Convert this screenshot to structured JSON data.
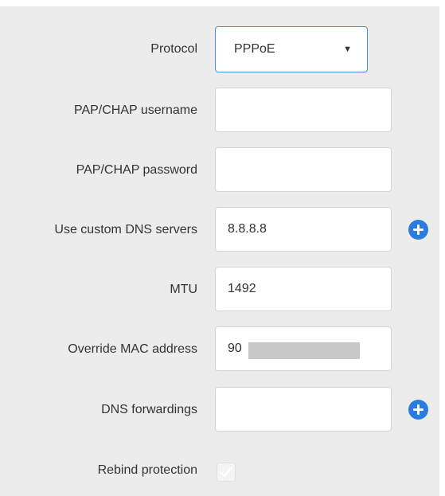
{
  "form": {
    "protocol": {
      "label": "Protocol",
      "selected": "PPPoE",
      "caret_icon": "caret-down-icon"
    },
    "username": {
      "label": "PAP/CHAP username",
      "value": ""
    },
    "password": {
      "label": "PAP/CHAP password",
      "value": ""
    },
    "dns_servers": {
      "label": "Use custom DNS servers",
      "value": "8.8.8.8",
      "add_icon": "plus-circle-icon"
    },
    "mtu": {
      "label": "MTU",
      "value": "1492"
    },
    "mac": {
      "label": "Override MAC address",
      "value": "90"
    },
    "dns_forwardings": {
      "label": "DNS forwardings",
      "value": "",
      "add_icon": "plus-circle-icon"
    },
    "rebind": {
      "label": "Rebind protection",
      "checked": true,
      "check_icon": "checkmark-icon"
    }
  },
  "colors": {
    "panel_bg": "#ececec",
    "accent": "#2b7be0",
    "select_border": "#4a90d9",
    "field_border": "#d5d5d5"
  }
}
